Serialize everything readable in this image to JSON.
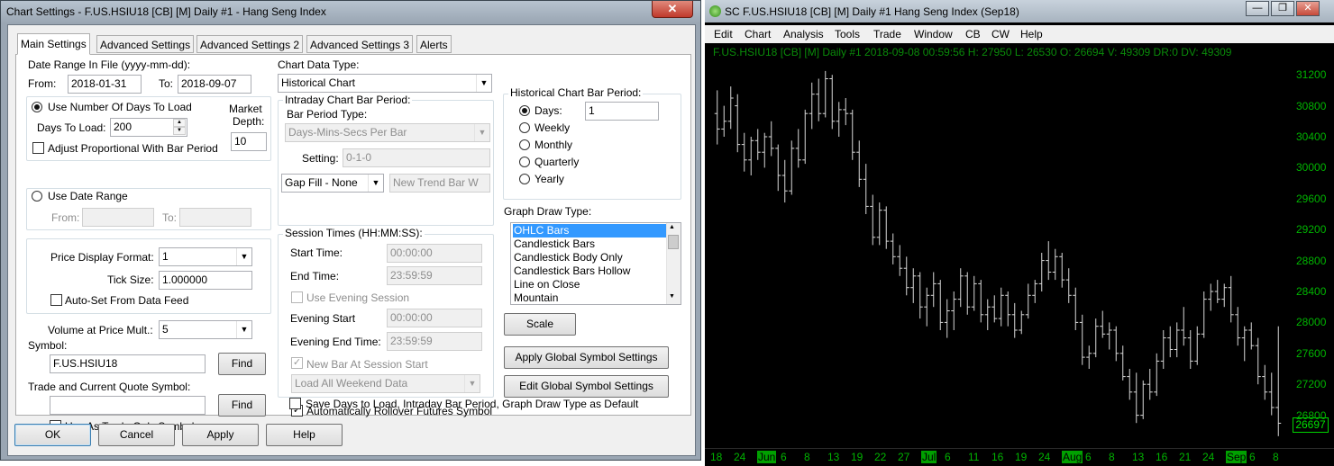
{
  "dialog": {
    "title": "Chart Settings - F.US.HSIU18 [CB] [M]  Daily  #1 - Hang Seng Index",
    "close_icon": "✕",
    "tabs": [
      "Main Settings",
      "Advanced Settings",
      "Advanced Settings 2",
      "Advanced Settings 3",
      "Alerts"
    ],
    "date_range": {
      "label": "Date Range In File (yyyy-mm-dd):",
      "from_label": "From:",
      "from_value": "2018-01-31",
      "to_label": "To:",
      "to_value": "2018-09-07"
    },
    "days_group": {
      "use_days_label": "Use Number Of Days To Load",
      "days_label": "Days To Load:",
      "days_value": "200",
      "market_depth_label1": "Market",
      "market_depth_label2": "Depth:",
      "market_depth_value": "10",
      "adjust_label": "Adjust Proportional With Bar Period"
    },
    "date_range_group": {
      "use_range_label": "Use Date Range",
      "from_label": "From:",
      "to_label": "To:"
    },
    "price_group": {
      "format_label": "Price Display Format:",
      "format_value": "1",
      "tick_label": "Tick Size:",
      "tick_value": "1.000000",
      "autoset_label": "Auto-Set From Data Feed"
    },
    "volume": {
      "label": "Volume at Price Mult.:",
      "value": "5"
    },
    "symbol": {
      "label": "Symbol:",
      "value": "F.US.HSIU18",
      "find_label": "Find"
    },
    "trade_symbol": {
      "label": "Trade and Current Quote Symbol:",
      "value": "",
      "find_label": "Find",
      "trade_only_label": "Use As Trade Only Symbol"
    },
    "chart_data_type": {
      "label": "Chart Data Type:",
      "value": "Historical Chart"
    },
    "intraday": {
      "group_label": "Intraday Chart Bar Period:",
      "period_type_label": "Bar Period Type:",
      "period_type_value": "Days-Mins-Secs Per Bar",
      "setting_label": "Setting:",
      "setting_value": "0-1-0",
      "gap_fill_value": "Gap Fill - None",
      "new_trend_value": "New Trend Bar W"
    },
    "session": {
      "group_label": "Session Times (HH:MM:SS):",
      "start_label": "Start Time:",
      "start_value": "00:00:00",
      "end_label": "End Time:",
      "end_value": "23:59:59",
      "use_evening_label": "Use Evening Session",
      "evening_start_label": "Evening Start",
      "evening_start_value": "00:00:00",
      "evening_end_label": "Evening End Time:",
      "evening_end_value": "23:59:59",
      "new_bar_label": "New Bar At Session Start",
      "weekend_value": "Load All Weekend Data"
    },
    "historical_period": {
      "group_label": "Historical Chart Bar Period:",
      "days_label": "Days:",
      "days_value": "1",
      "weekly_label": "Weekly",
      "monthly_label": "Monthly",
      "quarterly_label": "Quarterly",
      "yearly_label": "Yearly"
    },
    "graph_draw": {
      "label": "Graph Draw Type:",
      "items": [
        "OHLC Bars",
        "Candlestick Bars",
        "Candlestick Body Only",
        "Candlestick Bars Hollow",
        "Line on Close",
        "Mountain"
      ]
    },
    "scale_label": "Scale",
    "apply_global_label": "Apply Global Symbol Settings",
    "edit_global_label": "Edit Global Symbol Settings",
    "auto_rollover_label": "Automatically Rollover Futures Symbol",
    "save_default_label": "Save Days to Load, Intraday Bar Period, Graph Draw Type as Default",
    "buttons": {
      "ok": "OK",
      "cancel": "Cancel",
      "apply": "Apply",
      "help": "Help"
    }
  },
  "chart_window": {
    "title": "SC F.US.HSIU18 [CB] [M]  Daily  #1  Hang Seng Index (Sep18)",
    "minimize_icon": "—",
    "restore_icon": "❐",
    "close_icon": "✕",
    "menu": [
      "Edit",
      "Chart",
      "Analysis",
      "Tools",
      "Trade",
      "Window",
      "CB",
      "CW",
      "Help"
    ],
    "status_line": "F.US.HSIU18 [CB] [M]  Daily  #1 2018-09-08 00:59:56 H: 27950 L: 26530 O: 26694 V: 49309 DR:0 DV: 49309",
    "last_price": "26697",
    "colors": {
      "background": "#000000",
      "bars": "#d8d8d8",
      "axis_text": "#00b300",
      "month_label_bg": "#00a000"
    }
  },
  "chart_data": {
    "type": "ohlc",
    "ylim": [
      26400,
      31400
    ],
    "y_ticks": [
      "31200",
      "30800",
      "30400",
      "30000",
      "29600",
      "29200",
      "28800",
      "28400",
      "28000",
      "27600",
      "27200",
      "26800"
    ],
    "x_ticks": [
      "18",
      "24",
      "Jun",
      "6",
      "8",
      "13",
      "19",
      "22",
      "27",
      "Jul",
      "6",
      "11",
      "16",
      "19",
      "24",
      "Aug",
      "6",
      "8",
      "13",
      "16",
      "21",
      "24",
      "Sep",
      "6",
      "8"
    ],
    "month_ticks": [
      "Jun",
      "Jul",
      "Aug",
      "Sep"
    ],
    "bars": [
      {
        "o": 30700,
        "h": 31000,
        "l": 30300,
        "c": 30500
      },
      {
        "o": 30500,
        "h": 30800,
        "l": 30400,
        "c": 30600
      },
      {
        "o": 30600,
        "h": 31050,
        "l": 30500,
        "c": 30900
      },
      {
        "o": 30800,
        "h": 30950,
        "l": 30200,
        "c": 30300
      },
      {
        "o": 30300,
        "h": 30450,
        "l": 29950,
        "c": 30100
      },
      {
        "o": 30100,
        "h": 30400,
        "l": 29900,
        "c": 30350
      },
      {
        "o": 30350,
        "h": 30500,
        "l": 30100,
        "c": 30200
      },
      {
        "o": 30200,
        "h": 30450,
        "l": 30000,
        "c": 30400
      },
      {
        "o": 30400,
        "h": 30600,
        "l": 30150,
        "c": 30250
      },
      {
        "o": 30250,
        "h": 30300,
        "l": 29700,
        "c": 29900
      },
      {
        "o": 29900,
        "h": 30100,
        "l": 29550,
        "c": 29700
      },
      {
        "o": 29700,
        "h": 30350,
        "l": 29650,
        "c": 30250
      },
      {
        "o": 30250,
        "h": 30500,
        "l": 30000,
        "c": 30100
      },
      {
        "o": 30100,
        "h": 30750,
        "l": 30050,
        "c": 30700
      },
      {
        "o": 30700,
        "h": 31100,
        "l": 30500,
        "c": 30950
      },
      {
        "o": 30950,
        "h": 31150,
        "l": 30600,
        "c": 30700
      },
      {
        "o": 30700,
        "h": 31250,
        "l": 30650,
        "c": 31150
      },
      {
        "o": 31150,
        "h": 31200,
        "l": 30500,
        "c": 30600
      },
      {
        "o": 30600,
        "h": 30850,
        "l": 30400,
        "c": 30750
      },
      {
        "o": 30750,
        "h": 30900,
        "l": 30550,
        "c": 30700
      },
      {
        "o": 30700,
        "h": 30750,
        "l": 30100,
        "c": 30200
      },
      {
        "o": 30200,
        "h": 30350,
        "l": 29750,
        "c": 29850
      },
      {
        "o": 29850,
        "h": 30050,
        "l": 29400,
        "c": 29500
      },
      {
        "o": 29500,
        "h": 29650,
        "l": 29000,
        "c": 29100
      },
      {
        "o": 29100,
        "h": 29550,
        "l": 29000,
        "c": 29450
      },
      {
        "o": 29450,
        "h": 29500,
        "l": 28950,
        "c": 29050
      },
      {
        "o": 29050,
        "h": 29150,
        "l": 28750,
        "c": 28850
      },
      {
        "o": 28850,
        "h": 29000,
        "l": 28600,
        "c": 28700
      },
      {
        "o": 28700,
        "h": 28850,
        "l": 28350,
        "c": 28450
      },
      {
        "o": 28450,
        "h": 28700,
        "l": 28250,
        "c": 28600
      },
      {
        "o": 28600,
        "h": 28650,
        "l": 28050,
        "c": 28200
      },
      {
        "o": 28200,
        "h": 28450,
        "l": 27950,
        "c": 28350
      },
      {
        "o": 28350,
        "h": 28650,
        "l": 28200,
        "c": 28500
      },
      {
        "o": 28500,
        "h": 28550,
        "l": 27900,
        "c": 28000
      },
      {
        "o": 28000,
        "h": 28300,
        "l": 27800,
        "c": 28150
      },
      {
        "o": 28150,
        "h": 28400,
        "l": 27900,
        "c": 28300
      },
      {
        "o": 28300,
        "h": 28700,
        "l": 28200,
        "c": 28600
      },
      {
        "o": 28600,
        "h": 28650,
        "l": 28100,
        "c": 28200
      },
      {
        "o": 28200,
        "h": 28600,
        "l": 28150,
        "c": 28500
      },
      {
        "o": 28500,
        "h": 28550,
        "l": 28000,
        "c": 28100
      },
      {
        "o": 28100,
        "h": 28300,
        "l": 27900,
        "c": 28200
      },
      {
        "o": 28200,
        "h": 28350,
        "l": 28000,
        "c": 28050
      },
      {
        "o": 28050,
        "h": 28450,
        "l": 27950,
        "c": 28350
      },
      {
        "o": 28350,
        "h": 28400,
        "l": 27950,
        "c": 28100
      },
      {
        "o": 28100,
        "h": 28250,
        "l": 27800,
        "c": 27900
      },
      {
        "o": 27900,
        "h": 28150,
        "l": 27850,
        "c": 28100
      },
      {
        "o": 28100,
        "h": 28500,
        "l": 28050,
        "c": 28350
      },
      {
        "o": 28350,
        "h": 28550,
        "l": 28250,
        "c": 28500
      },
      {
        "o": 28500,
        "h": 28900,
        "l": 28400,
        "c": 28800
      },
      {
        "o": 28800,
        "h": 29050,
        "l": 28550,
        "c": 28650
      },
      {
        "o": 28650,
        "h": 28950,
        "l": 28550,
        "c": 28850
      },
      {
        "o": 28850,
        "h": 28900,
        "l": 28450,
        "c": 28550
      },
      {
        "o": 28550,
        "h": 28700,
        "l": 28250,
        "c": 28350
      },
      {
        "o": 28350,
        "h": 28450,
        "l": 27900,
        "c": 28000
      },
      {
        "o": 28000,
        "h": 28100,
        "l": 27450,
        "c": 27550
      },
      {
        "o": 27550,
        "h": 27700,
        "l": 27400,
        "c": 27600
      },
      {
        "o": 27600,
        "h": 28050,
        "l": 27550,
        "c": 27950
      },
      {
        "o": 27950,
        "h": 28150,
        "l": 27800,
        "c": 27850
      },
      {
        "o": 27850,
        "h": 28000,
        "l": 27650,
        "c": 27900
      },
      {
        "o": 27900,
        "h": 27950,
        "l": 27500,
        "c": 27600
      },
      {
        "o": 27600,
        "h": 27700,
        "l": 27250,
        "c": 27300
      },
      {
        "o": 27300,
        "h": 27400,
        "l": 27000,
        "c": 27100
      },
      {
        "o": 27100,
        "h": 27350,
        "l": 26700,
        "c": 26800
      },
      {
        "o": 26800,
        "h": 27250,
        "l": 26750,
        "c": 27200
      },
      {
        "o": 27200,
        "h": 27400,
        "l": 27000,
        "c": 27100
      },
      {
        "o": 27100,
        "h": 27600,
        "l": 27050,
        "c": 27500
      },
      {
        "o": 27500,
        "h": 27900,
        "l": 27400,
        "c": 27800
      },
      {
        "o": 27800,
        "h": 27950,
        "l": 27550,
        "c": 27650
      },
      {
        "o": 27650,
        "h": 28000,
        "l": 27550,
        "c": 27900
      },
      {
        "o": 27900,
        "h": 28200,
        "l": 27700,
        "c": 27800
      },
      {
        "o": 27800,
        "h": 27900,
        "l": 27400,
        "c": 27500
      },
      {
        "o": 27500,
        "h": 27950,
        "l": 27450,
        "c": 27850
      },
      {
        "o": 27850,
        "h": 28400,
        "l": 27800,
        "c": 28300
      },
      {
        "o": 28300,
        "h": 28500,
        "l": 28150,
        "c": 28400
      },
      {
        "o": 28400,
        "h": 28550,
        "l": 28250,
        "c": 28300
      },
      {
        "o": 28300,
        "h": 28500,
        "l": 28200,
        "c": 28450
      },
      {
        "o": 28450,
        "h": 28600,
        "l": 28000,
        "c": 28100
      },
      {
        "o": 28100,
        "h": 28200,
        "l": 27700,
        "c": 27800
      },
      {
        "o": 27800,
        "h": 27950,
        "l": 27500,
        "c": 27900
      },
      {
        "o": 27900,
        "h": 28000,
        "l": 27650,
        "c": 27700
      },
      {
        "o": 27700,
        "h": 27800,
        "l": 27200,
        "c": 27300
      },
      {
        "o": 27300,
        "h": 27450,
        "l": 27000,
        "c": 27100
      },
      {
        "o": 27100,
        "h": 27350,
        "l": 26800,
        "c": 26900
      },
      {
        "o": 26900,
        "h": 27950,
        "l": 26530,
        "c": 26697
      }
    ]
  }
}
